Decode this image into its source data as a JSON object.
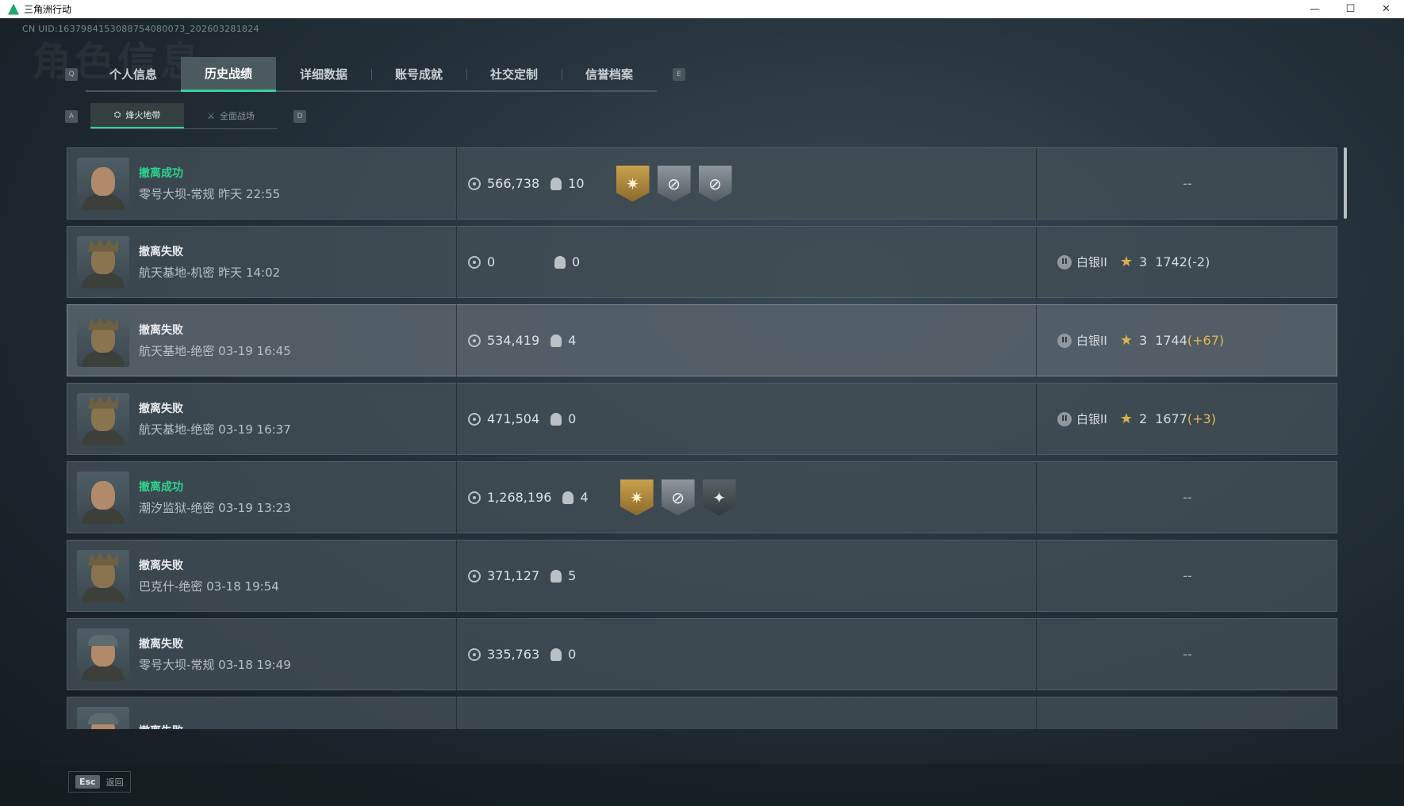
{
  "window": {
    "title": "三角洲行动",
    "minimize": "—",
    "maximize": "☐",
    "close": "✕"
  },
  "uid": "CN UID:1637984153088754080073_202603281824",
  "ghost_title": "角色信息",
  "tabs": {
    "left_key": "Q",
    "right_key": "E",
    "items": [
      {
        "label": "个人信息"
      },
      {
        "label": "历史战绩"
      },
      {
        "label": "详细数据"
      },
      {
        "label": "账号成就"
      },
      {
        "label": "社交定制"
      },
      {
        "label": "信誉档案"
      }
    ]
  },
  "subtabs": {
    "left_key": "A",
    "right_key": "D",
    "items": [
      {
        "label": "烽火地带",
        "icon": "flame-zone-icon"
      },
      {
        "label": "全面战场",
        "icon": "battlefield-icon"
      }
    ]
  },
  "records": [
    {
      "status": "撤离成功",
      "meta": "零号大坝-常规 昨天 22:55",
      "value": "566,738",
      "kills": "10",
      "badges": [
        "gold",
        "silver",
        "silver"
      ],
      "rank": null
    },
    {
      "status": "撤离失败",
      "meta": "航天基地-机密 昨天 14:02",
      "value": "0",
      "kills": "0",
      "badges": [],
      "rank": {
        "icon": "II",
        "name": "白银II",
        "stars": "3",
        "score": "1742",
        "delta": "(-2)"
      }
    },
    {
      "status": "撤离失败",
      "meta": "航天基地-绝密 03-19 16:45",
      "value": "534,419",
      "kills": "4",
      "badges": [],
      "rank": {
        "icon": "II",
        "name": "白银II",
        "stars": "3",
        "score": "1744",
        "delta": "(+67)"
      }
    },
    {
      "status": "撤离失败",
      "meta": "航天基地-绝密 03-19 16:37",
      "value": "471,504",
      "kills": "0",
      "badges": [],
      "rank": {
        "icon": "II",
        "name": "白银II",
        "stars": "2",
        "score": "1677",
        "delta": "(+3)"
      }
    },
    {
      "status": "撤离成功",
      "meta": "潮汐监狱-绝密 03-19 13:23",
      "value": "1,268,196",
      "kills": "4",
      "badges": [
        "gold",
        "silver",
        "dark"
      ],
      "rank": null
    },
    {
      "status": "撤离失败",
      "meta": "巴克什-绝密 03-18 19:54",
      "value": "371,127",
      "kills": "5",
      "badges": [],
      "rank": null
    },
    {
      "status": "撤离失败",
      "meta": "零号大坝-常规 03-18 19:49",
      "value": "335,763",
      "kills": "0",
      "badges": [],
      "rank": null
    },
    {
      "status": "撤离失败",
      "meta": "",
      "value": "",
      "kills": "",
      "badges": [],
      "rank": null
    }
  ],
  "empty_rank": "--",
  "footer": {
    "key": "Esc",
    "label": "返回"
  },
  "colors": {
    "accent": "#35d39a",
    "success": "#2fd38e",
    "gold_delta": "#e2b84f"
  }
}
